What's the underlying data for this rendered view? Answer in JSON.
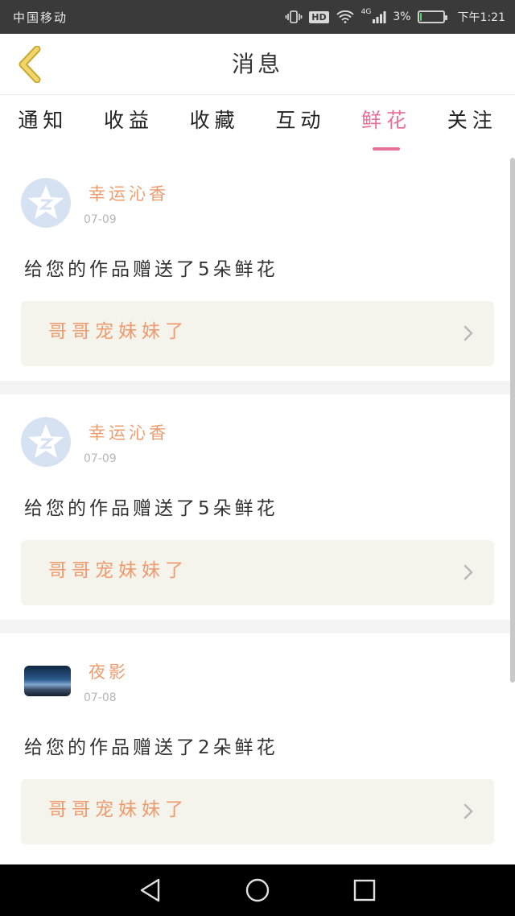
{
  "status_bar": {
    "carrier": "中国移动",
    "hd": "HD",
    "network": "4G",
    "battery_percent": "3%",
    "battery_level": 0.03,
    "time": "下午1:21"
  },
  "header": {
    "title": "消息"
  },
  "tabs": [
    {
      "label": "通知"
    },
    {
      "label": "收益"
    },
    {
      "label": "收藏"
    },
    {
      "label": "互动"
    },
    {
      "label": "鲜花"
    },
    {
      "label": "关注"
    }
  ],
  "active_tab": "鲜花",
  "messages": [
    {
      "user": "幸运沁香",
      "date": "07-09",
      "text": "给您的作品赠送了5朵鲜花",
      "work": "哥哥宠妹妹了",
      "avatar": "default-avatar-icon"
    },
    {
      "user": "幸运沁香",
      "date": "07-09",
      "text": "给您的作品赠送了5朵鲜花",
      "work": "哥哥宠妹妹了",
      "avatar": "default-avatar-icon"
    },
    {
      "user": "夜影",
      "date": "07-08",
      "text": "给您的作品赠送了2朵鲜花",
      "work": "哥哥宠妹妹了",
      "avatar": "photo-avatar"
    }
  ],
  "colors": {
    "accent": "#e8719a",
    "name": "#ee9b6e",
    "back_arrow": "#f1d66b",
    "card_bg": "#f4f3ec"
  }
}
